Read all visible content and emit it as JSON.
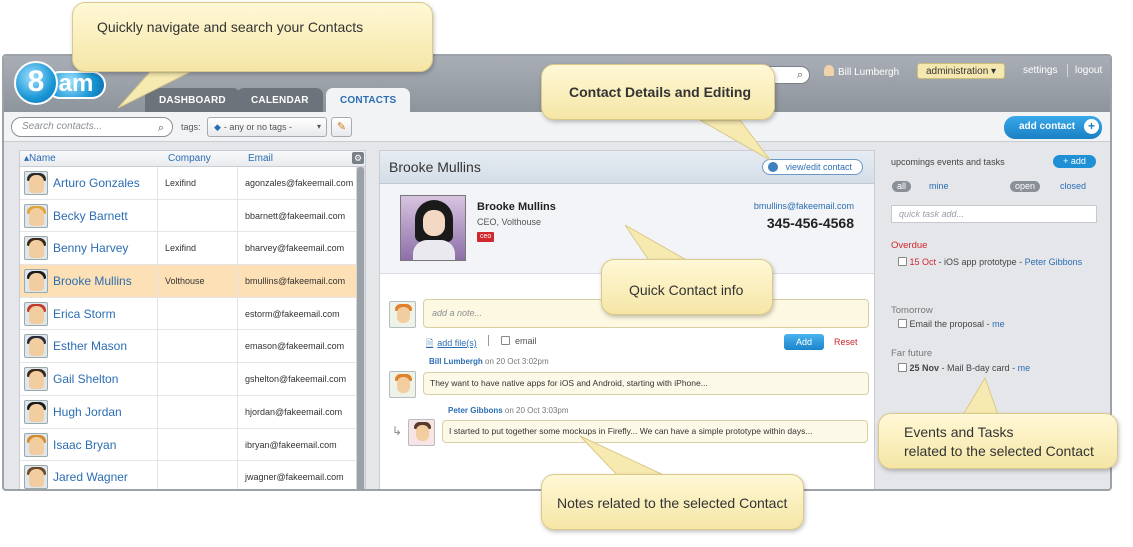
{
  "app": {
    "logo_text": "8am",
    "tabs": [
      "DASHBOARD",
      "CALENDAR",
      "CONTACTS"
    ],
    "user_name": "Bill Lumbergh",
    "role_select": "administration",
    "settings_label": "settings",
    "logout_label": "logout"
  },
  "toolbar": {
    "search_placeholder": "Search contacts...",
    "tags_label": "tags:",
    "tags_select": "- any or no tags -",
    "add_contact_label": "add contact",
    "add_icon": "+"
  },
  "contacts": {
    "columns": [
      "Name",
      "Company",
      "Email"
    ],
    "rows": [
      {
        "name": "Arturo Gonzales",
        "company": "Lexifind",
        "email": "agonzales@fakeemail.com",
        "hair": "#2a2a2a",
        "shirt": "#3d5a8a"
      },
      {
        "name": "Becky Barnett",
        "company": "",
        "email": "bbarnett@fakeemail.com",
        "hair": "#e0a53a",
        "shirt": "#c24b7a"
      },
      {
        "name": "Benny Harvey",
        "company": "Lexifind",
        "email": "bharvey@fakeemail.com",
        "hair": "#3a2a1a",
        "shirt": "#5a7a3a"
      },
      {
        "name": "Brooke Mullins",
        "company": "Volthouse",
        "email": "bmullins@fakeemail.com",
        "hair": "#1a1a1a",
        "shirt": "#e9e9ef",
        "selected": true
      },
      {
        "name": "Erica Storm",
        "company": "",
        "email": "estorm@fakeemail.com",
        "hair": "#c23a2a",
        "shirt": "#6aa0c8"
      },
      {
        "name": "Esther Mason",
        "company": "",
        "email": "emason@fakeemail.com",
        "hair": "#2a2a3a",
        "shirt": "#3a3a5a"
      },
      {
        "name": "Gail Shelton",
        "company": "",
        "email": "gshelton@fakeemail.com",
        "hair": "#3a2a1a",
        "shirt": "#2e6ea8"
      },
      {
        "name": "Hugh Jordan",
        "company": "",
        "email": "hjordan@fakeemail.com",
        "hair": "#1a1a1a",
        "shirt": "#4a4a6a"
      },
      {
        "name": "Isaac Bryan",
        "company": "",
        "email": "ibryan@fakeemail.com",
        "hair": "#d48a2a",
        "shirt": "#3a8a5a"
      },
      {
        "name": "Jared Wagner",
        "company": "",
        "email": "jwagner@fakeemail.com",
        "hair": "#6a4a2a",
        "shirt": "#8a6a3a"
      }
    ]
  },
  "detail": {
    "title": "Brooke Mullins",
    "view_edit_label": "view/edit contact",
    "name": "Brooke Mullins",
    "job": "CEO, Volthouse",
    "tag": "ceo",
    "email": "bmullins@fakeemail.com",
    "phone": "345-456-4568",
    "note_placeholder": "add a note...",
    "add_files_label": "add file(s)",
    "email_label": "email",
    "add_label": "Add",
    "reset_label": "Reset",
    "notes": [
      {
        "author": "Bill Lumbergh",
        "date": "on 20 Oct 3:02pm",
        "text": "They want to have native apps for iOS and Android, starting with iPhone..."
      },
      {
        "author": "Peter Gibbons",
        "date": "on 20 Oct 3:03pm",
        "text": "I started to put together some mockups in Firefly... We can have a simple prototype within days..."
      }
    ]
  },
  "sidebar": {
    "title": "upcomings events and tasks",
    "add_label": "+ add",
    "filter_all": "all",
    "filter_mine": "mine",
    "filter_open": "open",
    "filter_closed": "closed",
    "quick_placeholder": "quick task add...",
    "sections": [
      {
        "title": "Overdue",
        "date": "15 Oct",
        "task": "- iOS app prototype -",
        "who": "Peter Gibbons"
      },
      {
        "title": "Tomorrow",
        "date": "",
        "task": "Email the proposal -",
        "who": "me"
      },
      {
        "title": "Far future",
        "date": "25 Nov",
        "task": "- Mail B-day card -",
        "who": "me"
      }
    ]
  },
  "callouts": {
    "navigate": "Quickly navigate and search your Contacts",
    "details": "Contact Details and Editing",
    "quick_info": "Quick Contact info",
    "events_line1": "Events and Tasks",
    "events_line2": "related to the selected Contact",
    "notes": "Notes related to the selected Contact"
  },
  "colors": {
    "accent": "#2b6db3",
    "selected_row": "#fde0b5",
    "danger": "#d0282e"
  }
}
